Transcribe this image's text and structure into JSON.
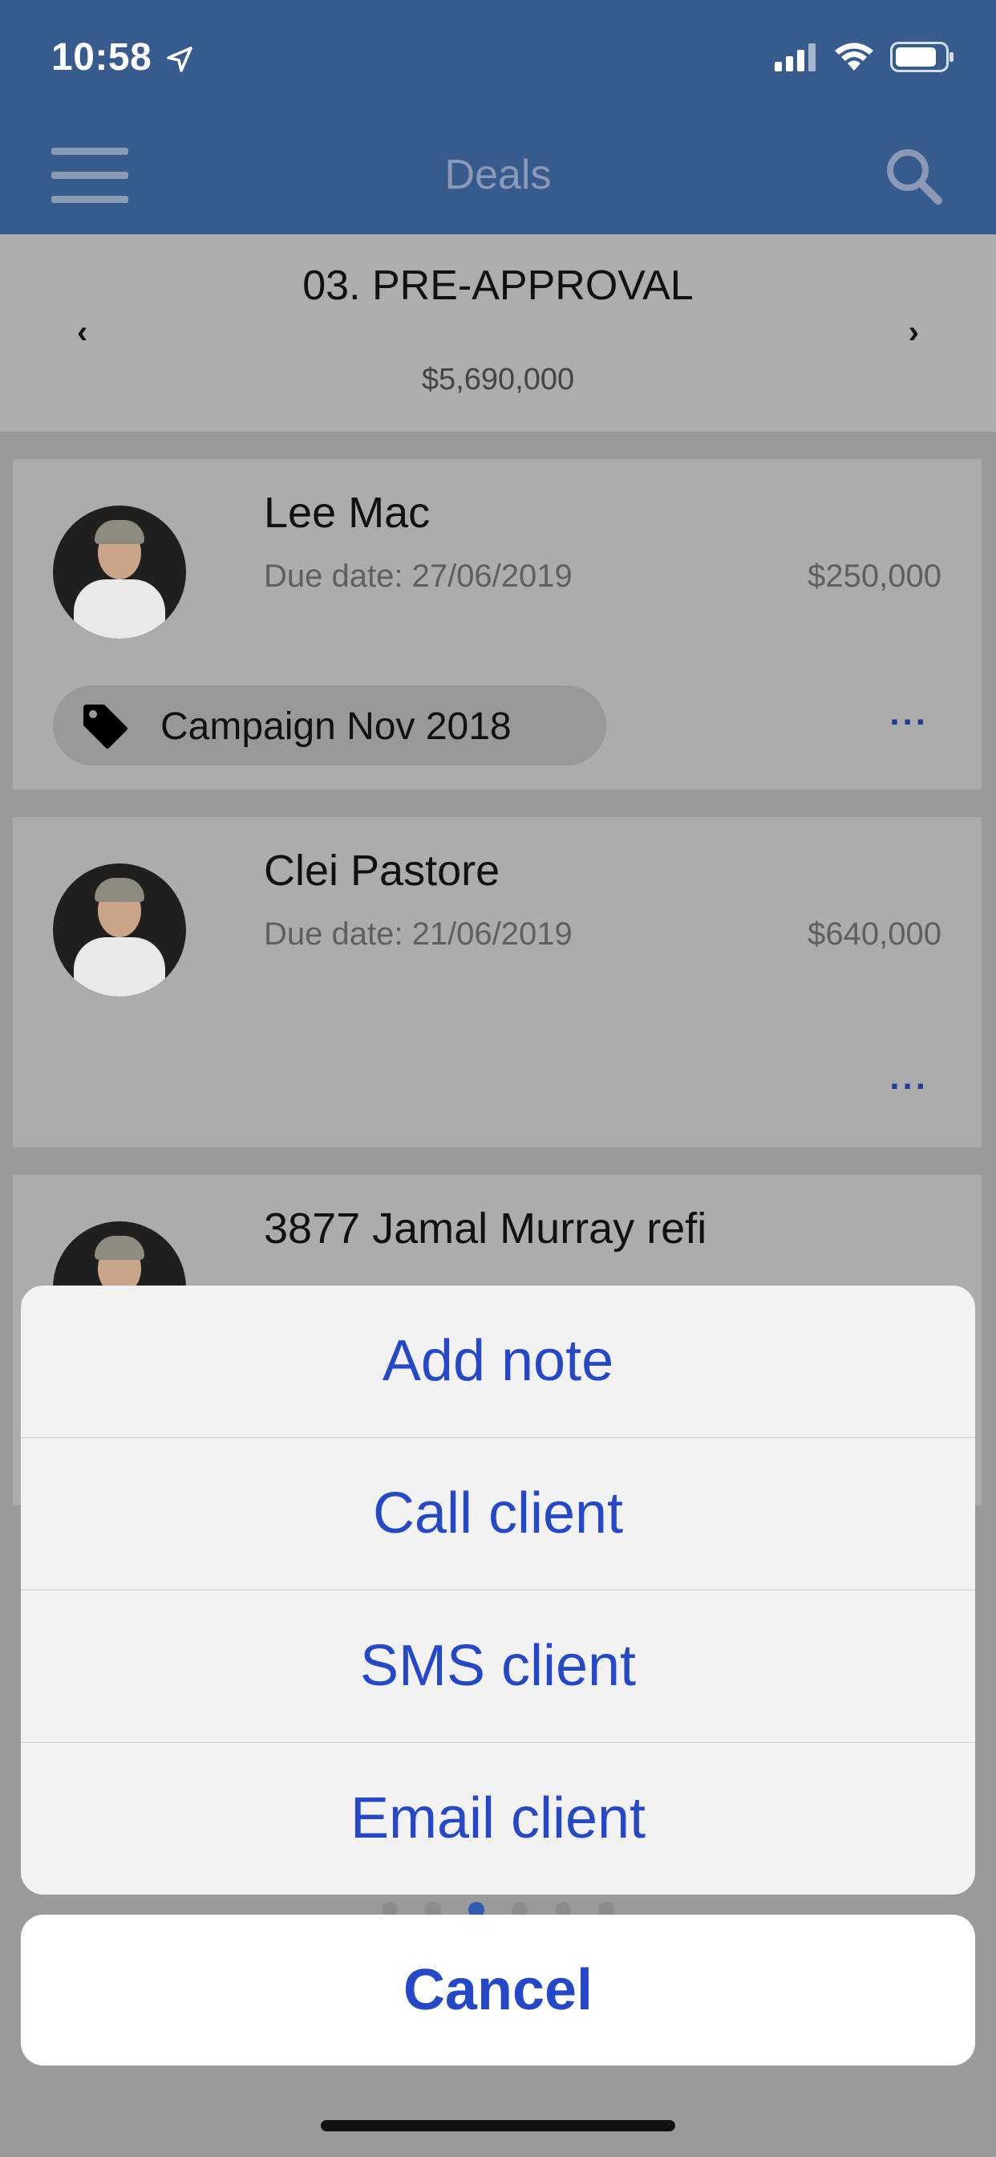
{
  "status_bar": {
    "time": "10:58"
  },
  "nav": {
    "title": "Deals"
  },
  "stage": {
    "title": "03. PRE-APPROVAL",
    "amount": "$5,690,000",
    "prev": "‹",
    "next": "›"
  },
  "deals": [
    {
      "name": "Lee Mac",
      "due": "Due date: 27/06/2019",
      "amount": "$250,000",
      "tag": "Campaign Nov 2018",
      "more": "..."
    },
    {
      "name": "Clei Pastore",
      "due": "Due date: 21/06/2019",
      "amount": "$640,000",
      "more": "..."
    },
    {
      "name": "3877 Jamal Murray refi"
    }
  ],
  "pager": {
    "count": 6,
    "active": 2
  },
  "action_sheet": {
    "options": [
      "Add note",
      "Call client",
      "SMS client",
      "Email client"
    ],
    "cancel": "Cancel"
  },
  "colors": {
    "nav_bar": "#385b8e",
    "action_text": "#2448c8"
  }
}
